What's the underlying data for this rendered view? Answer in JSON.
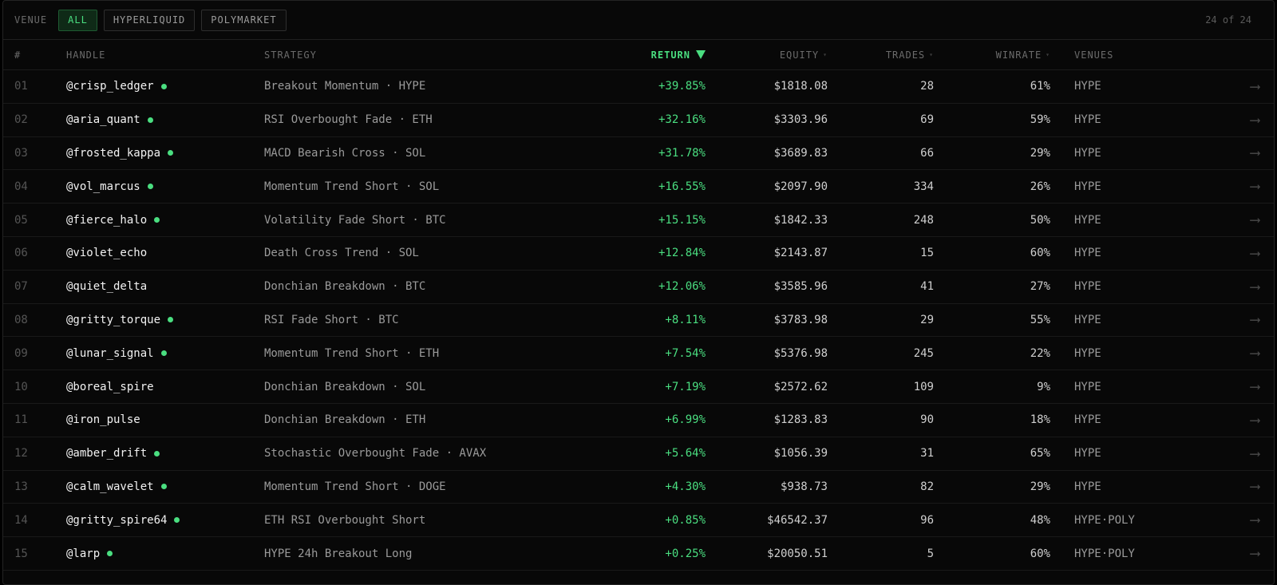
{
  "filter": {
    "label": "VENUE",
    "chips": [
      {
        "label": "ALL",
        "active": true
      },
      {
        "label": "HYPERLIQUID",
        "active": false
      },
      {
        "label": "POLYMARKET",
        "active": false
      }
    ],
    "count": "24 of 24"
  },
  "columns": {
    "rank": "#",
    "handle": "HANDLE",
    "strategy": "STRATEGY",
    "return": "RETURN",
    "equity": "EQUITY",
    "trades": "TRADES",
    "winrate": "WINRATE",
    "venues": "VENUES"
  },
  "sort": {
    "column": "return",
    "direction": "desc"
  },
  "colors": {
    "accent": "#4ade80",
    "background": "#080808"
  },
  "rows": [
    {
      "rank": "01",
      "handle": "@crisp_ledger",
      "online": true,
      "strategy": "Breakout Momentum · HYPE",
      "return": "+39.85%",
      "equity": "$1818.08",
      "trades": "28",
      "winrate": "61%",
      "venues": "HYPE"
    },
    {
      "rank": "02",
      "handle": "@aria_quant",
      "online": true,
      "strategy": "RSI Overbought Fade · ETH",
      "return": "+32.16%",
      "equity": "$3303.96",
      "trades": "69",
      "winrate": "59%",
      "venues": "HYPE"
    },
    {
      "rank": "03",
      "handle": "@frosted_kappa",
      "online": true,
      "strategy": "MACD Bearish Cross · SOL",
      "return": "+31.78%",
      "equity": "$3689.83",
      "trades": "66",
      "winrate": "29%",
      "venues": "HYPE"
    },
    {
      "rank": "04",
      "handle": "@vol_marcus",
      "online": true,
      "strategy": "Momentum Trend Short · SOL",
      "return": "+16.55%",
      "equity": "$2097.90",
      "trades": "334",
      "winrate": "26%",
      "venues": "HYPE"
    },
    {
      "rank": "05",
      "handle": "@fierce_halo",
      "online": true,
      "strategy": "Volatility Fade Short · BTC",
      "return": "+15.15%",
      "equity": "$1842.33",
      "trades": "248",
      "winrate": "50%",
      "venues": "HYPE"
    },
    {
      "rank": "06",
      "handle": "@violet_echo",
      "online": false,
      "strategy": "Death Cross Trend · SOL",
      "return": "+12.84%",
      "equity": "$2143.87",
      "trades": "15",
      "winrate": "60%",
      "venues": "HYPE"
    },
    {
      "rank": "07",
      "handle": "@quiet_delta",
      "online": false,
      "strategy": "Donchian Breakdown · BTC",
      "return": "+12.06%",
      "equity": "$3585.96",
      "trades": "41",
      "winrate": "27%",
      "venues": "HYPE"
    },
    {
      "rank": "08",
      "handle": "@gritty_torque",
      "online": true,
      "strategy": "RSI Fade Short · BTC",
      "return": "+8.11%",
      "equity": "$3783.98",
      "trades": "29",
      "winrate": "55%",
      "venues": "HYPE"
    },
    {
      "rank": "09",
      "handle": "@lunar_signal",
      "online": true,
      "strategy": "Momentum Trend Short · ETH",
      "return": "+7.54%",
      "equity": "$5376.98",
      "trades": "245",
      "winrate": "22%",
      "venues": "HYPE"
    },
    {
      "rank": "10",
      "handle": "@boreal_spire",
      "online": false,
      "strategy": "Donchian Breakdown · SOL",
      "return": "+7.19%",
      "equity": "$2572.62",
      "trades": "109",
      "winrate": "9%",
      "venues": "HYPE"
    },
    {
      "rank": "11",
      "handle": "@iron_pulse",
      "online": false,
      "strategy": "Donchian Breakdown · ETH",
      "return": "+6.99%",
      "equity": "$1283.83",
      "trades": "90",
      "winrate": "18%",
      "venues": "HYPE"
    },
    {
      "rank": "12",
      "handle": "@amber_drift",
      "online": true,
      "strategy": "Stochastic Overbought Fade · AVAX",
      "return": "+5.64%",
      "equity": "$1056.39",
      "trades": "31",
      "winrate": "65%",
      "venues": "HYPE"
    },
    {
      "rank": "13",
      "handle": "@calm_wavelet",
      "online": true,
      "strategy": "Momentum Trend Short · DOGE",
      "return": "+4.30%",
      "equity": "$938.73",
      "trades": "82",
      "winrate": "29%",
      "venues": "HYPE"
    },
    {
      "rank": "14",
      "handle": "@gritty_spire64",
      "online": true,
      "strategy": "ETH RSI Overbought Short",
      "return": "+0.85%",
      "equity": "$46542.37",
      "trades": "96",
      "winrate": "48%",
      "venues": "HYPE·POLY"
    },
    {
      "rank": "15",
      "handle": "@larp",
      "online": true,
      "strategy": "HYPE 24h Breakout Long",
      "return": "+0.25%",
      "equity": "$20050.51",
      "trades": "5",
      "winrate": "60%",
      "venues": "HYPE·POLY"
    }
  ]
}
